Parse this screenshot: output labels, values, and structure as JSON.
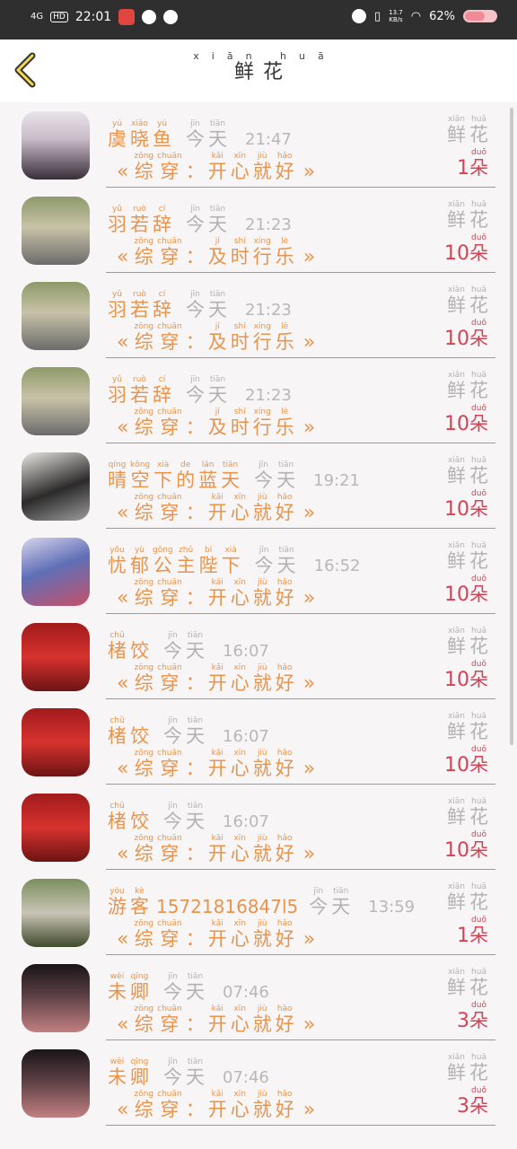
{
  "status_bar": {
    "network": "4G",
    "hd": "HD",
    "time": "22:01",
    "speed_value": "13.7",
    "speed_unit": "KB/s",
    "battery": "62%"
  },
  "header": {
    "title_pinyin": "xiān huā",
    "title": "鲜花",
    "back_icon": "chevron-left-icon"
  },
  "colors": {
    "accent": "#e8944c",
    "count": "#d94054",
    "muted": "#b3b3b3"
  },
  "flower_label": {
    "pinyin": [
      "xiān",
      "huā"
    ],
    "chars": [
      "鲜",
      "花"
    ]
  },
  "unit": {
    "pinyin": "duǒ",
    "char": "朵"
  },
  "rows": [
    {
      "avatar": "anime-girl-dark-hair",
      "name_py": [
        "yú",
        "xiǎo",
        "yú"
      ],
      "name_hz": [
        "虞",
        "晓",
        "鱼"
      ],
      "day_py": [
        "jīn",
        "tiān"
      ],
      "day_hz": [
        "今",
        "天"
      ],
      "time": "21:47",
      "msg_py": [
        "zōng",
        "chuān",
        "",
        "kāi",
        "xīn",
        "jiù",
        "hǎo"
      ],
      "msg_hz": [
        "综",
        "穿",
        "：",
        "开",
        "心",
        "就",
        "好"
      ],
      "count": "1"
    },
    {
      "avatar": "anime-boy-green",
      "name_py": [
        "yǔ",
        "ruò",
        "cí"
      ],
      "name_hz": [
        "羽",
        "若",
        "辞"
      ],
      "day_py": [
        "jīn",
        "tiān"
      ],
      "day_hz": [
        "今",
        "天"
      ],
      "time": "21:23",
      "msg_py": [
        "zōng",
        "chuān",
        "",
        "jí",
        "shí",
        "xíng",
        "lè"
      ],
      "msg_hz": [
        "综",
        "穿",
        "：",
        "及",
        "时",
        "行",
        "乐"
      ],
      "count": "10"
    },
    {
      "avatar": "anime-boy-green",
      "name_py": [
        "yǔ",
        "ruò",
        "cí"
      ],
      "name_hz": [
        "羽",
        "若",
        "辞"
      ],
      "day_py": [
        "jīn",
        "tiān"
      ],
      "day_hz": [
        "今",
        "天"
      ],
      "time": "21:23",
      "msg_py": [
        "zōng",
        "chuān",
        "",
        "jí",
        "shí",
        "xíng",
        "lè"
      ],
      "msg_hz": [
        "综",
        "穿",
        "：",
        "及",
        "时",
        "行",
        "乐"
      ],
      "count": "10"
    },
    {
      "avatar": "anime-boy-green",
      "name_py": [
        "yǔ",
        "ruò",
        "cí"
      ],
      "name_hz": [
        "羽",
        "若",
        "辞"
      ],
      "day_py": [
        "jīn",
        "tiān"
      ],
      "day_hz": [
        "今",
        "天"
      ],
      "time": "21:23",
      "msg_py": [
        "zōng",
        "chuān",
        "",
        "jí",
        "shí",
        "xíng",
        "lè"
      ],
      "msg_hz": [
        "综",
        "穿",
        "：",
        "及",
        "时",
        "行",
        "乐"
      ],
      "count": "10"
    },
    {
      "avatar": "ancient-costume-man",
      "name_py": [
        "qíng",
        "kōng",
        "xià",
        "de",
        "lán",
        "tiān"
      ],
      "name_hz": [
        "晴",
        "空",
        "下",
        "的",
        "蓝",
        "天"
      ],
      "day_py": [
        "jīn",
        "tiān"
      ],
      "day_hz": [
        "今",
        "天"
      ],
      "time": "19:21",
      "msg_py": [
        "zōng",
        "chuān",
        "",
        "kāi",
        "xīn",
        "jiù",
        "hǎo"
      ],
      "msg_hz": [
        "综",
        "穿",
        "：",
        "开",
        "心",
        "就",
        "好"
      ],
      "count": "10"
    },
    {
      "avatar": "anime-princess",
      "name_py": [
        "yōu",
        "yù",
        "gōng",
        "zhǔ",
        "bì",
        "xià"
      ],
      "name_hz": [
        "忧",
        "郁",
        "公",
        "主",
        "陛",
        "下"
      ],
      "day_py": [
        "jīn",
        "tiān"
      ],
      "day_hz": [
        "今",
        "天"
      ],
      "time": "16:52",
      "msg_py": [
        "zōng",
        "chuān",
        "",
        "kāi",
        "xīn",
        "jiù",
        "hǎo"
      ],
      "msg_hz": [
        "综",
        "穿",
        "：",
        "开",
        "心",
        "就",
        "好"
      ],
      "count": "10"
    },
    {
      "avatar": "red-lantern-photo",
      "name_py": [
        "chǔ",
        ""
      ],
      "name_hz": [
        "楮",
        "饺"
      ],
      "day_py": [
        "jīn",
        "tiān"
      ],
      "day_hz": [
        "今",
        "天"
      ],
      "time": "16:07",
      "msg_py": [
        "zōng",
        "chuān",
        "",
        "kāi",
        "xīn",
        "jiù",
        "hǎo"
      ],
      "msg_hz": [
        "综",
        "穿",
        "：",
        "开",
        "心",
        "就",
        "好"
      ],
      "count": "10"
    },
    {
      "avatar": "red-lantern-photo",
      "name_py": [
        "chǔ",
        ""
      ],
      "name_hz": [
        "楮",
        "饺"
      ],
      "day_py": [
        "jīn",
        "tiān"
      ],
      "day_hz": [
        "今",
        "天"
      ],
      "time": "16:07",
      "msg_py": [
        "zōng",
        "chuān",
        "",
        "kāi",
        "xīn",
        "jiù",
        "hǎo"
      ],
      "msg_hz": [
        "综",
        "穿",
        "：",
        "开",
        "心",
        "就",
        "好"
      ],
      "count": "10"
    },
    {
      "avatar": "red-lantern-photo",
      "name_py": [
        "chǔ",
        ""
      ],
      "name_hz": [
        "楮",
        "饺"
      ],
      "day_py": [
        "jīn",
        "tiān"
      ],
      "day_hz": [
        "今",
        "天"
      ],
      "time": "16:07",
      "msg_py": [
        "zōng",
        "chuān",
        "",
        "kāi",
        "xīn",
        "jiù",
        "hǎo"
      ],
      "msg_hz": [
        "综",
        "穿",
        "：",
        "开",
        "心",
        "就",
        "好"
      ],
      "count": "10"
    },
    {
      "avatar": "child-photo",
      "name_py": [
        "yóu",
        "kè"
      ],
      "name_hz": [
        "游",
        "客"
      ],
      "name_extra": "15721816847l5",
      "day_py": [
        "jīn",
        "tiān"
      ],
      "day_hz": [
        "今",
        "天"
      ],
      "time": "13:59",
      "msg_py": [
        "zōng",
        "chuān",
        "",
        "kāi",
        "xīn",
        "jiù",
        "hǎo"
      ],
      "msg_hz": [
        "综",
        "穿",
        "：",
        "开",
        "心",
        "就",
        "好"
      ],
      "count": "1"
    },
    {
      "avatar": "girl-photo-dark",
      "name_py": [
        "wèi",
        "qīng"
      ],
      "name_hz": [
        "未",
        "卿"
      ],
      "day_py": [
        "jīn",
        "tiān"
      ],
      "day_hz": [
        "今",
        "天"
      ],
      "time": "07:46",
      "msg_py": [
        "zōng",
        "chuān",
        "",
        "kāi",
        "xīn",
        "jiù",
        "hǎo"
      ],
      "msg_hz": [
        "综",
        "穿",
        "：",
        "开",
        "心",
        "就",
        "好"
      ],
      "count": "3"
    },
    {
      "avatar": "girl-photo-dark",
      "name_py": [
        "wèi",
        "qīng"
      ],
      "name_hz": [
        "未",
        "卿"
      ],
      "day_py": [
        "jīn",
        "tiān"
      ],
      "day_hz": [
        "今",
        "天"
      ],
      "time": "07:46",
      "msg_py": [
        "zōng",
        "chuān",
        "",
        "kāi",
        "xīn",
        "jiù",
        "hǎo"
      ],
      "msg_hz": [
        "综",
        "穿",
        "：",
        "开",
        "心",
        "就",
        "好"
      ],
      "count": "3"
    }
  ]
}
